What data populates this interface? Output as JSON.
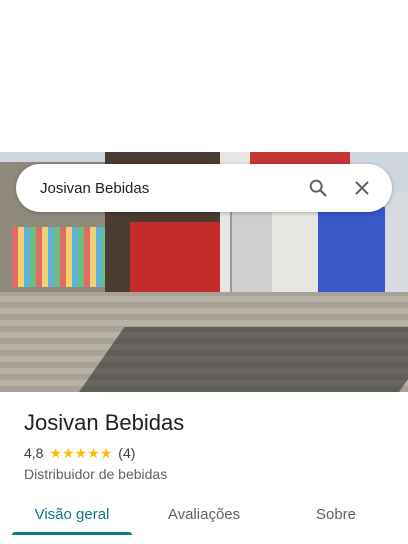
{
  "search": {
    "query": "Josivan Bebidas"
  },
  "place": {
    "name": "Josivan Bebidas",
    "rating": "4,8",
    "stars": 5,
    "reviews_count": "(4)",
    "category": "Distribuidor de bebidas"
  },
  "tabs": [
    {
      "label": "Visão geral",
      "active": true
    },
    {
      "label": "Avaliações",
      "active": false
    },
    {
      "label": "Sobre",
      "active": false
    }
  ],
  "icons": {
    "search": "search-icon",
    "close": "close-icon",
    "star": "star-icon"
  },
  "colors": {
    "accent": "#0b7a86",
    "star": "#fbbc04",
    "text": "#202124",
    "secondary": "#5f6368"
  }
}
